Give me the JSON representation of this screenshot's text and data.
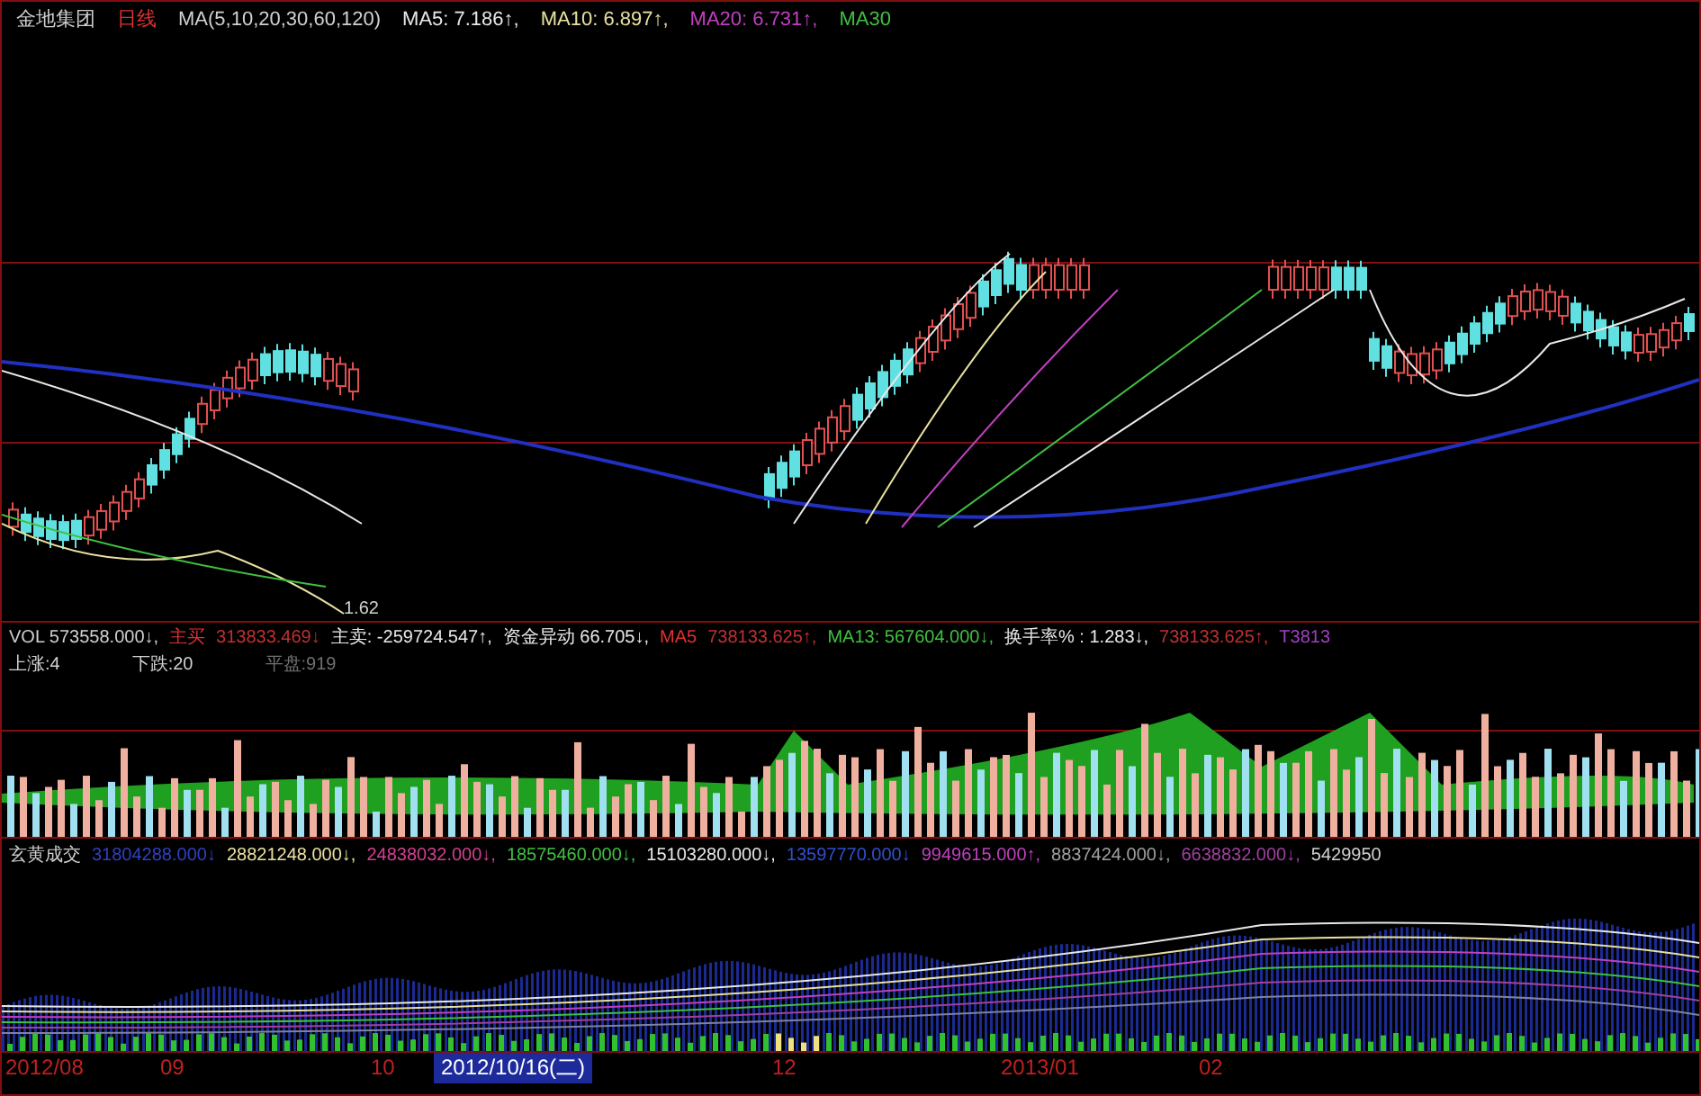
{
  "price_panel": {
    "header": [
      {
        "text": "金地集团",
        "color": "#d0d0d0"
      },
      {
        "text": "日线",
        "color": "#e03030"
      },
      {
        "text": "MA(5,10,20,30,60,120)",
        "color": "#d0d0d0"
      },
      {
        "text": "MA5: 7.186↑,",
        "color": "#e8e8e8"
      },
      {
        "text": "MA10: 6.897↑,",
        "color": "#e8e0a0"
      },
      {
        "text": "MA20: 6.731↑,",
        "color": "#c040c0"
      },
      {
        "text": "MA30",
        "color": "#40c040"
      }
    ],
    "low_label": "1.62"
  },
  "volume_panel": {
    "header": [
      {
        "text": "VOL 573558.000↓,",
        "color": "#d0d0d0"
      },
      {
        "text": "主买",
        "color": "#e03030"
      },
      {
        "text": "313833.469↓",
        "color": "#c03030"
      },
      {
        "text": "主卖: -259724.547↑,",
        "color": "#e8e8e8"
      },
      {
        "text": "资金异动 66.705↓,",
        "color": "#e8e8e8"
      },
      {
        "text": "MA5",
        "color": "#e03030"
      },
      {
        "text": "738133.625↑,",
        "color": "#c03030"
      },
      {
        "text": "MA13: 567604.000↓,",
        "color": "#40c040"
      },
      {
        "text": "换手率% : 1.283↓,",
        "color": "#e8e8e8"
      },
      {
        "text": "738133.625↑,",
        "color": "#c03030"
      },
      {
        "text": "T3813",
        "color": "#a040c0"
      }
    ],
    "stats": [
      {
        "text": "上涨:4",
        "color": "#d0d0d0"
      },
      {
        "text": "下跌:20",
        "color": "#d0d0d0"
      },
      {
        "text": "平盘:919",
        "color": "#707070"
      }
    ]
  },
  "turnover_panel": {
    "header": [
      {
        "text": "玄黄成交",
        "color": "#d0d0d0"
      },
      {
        "text": "31804288.000↓",
        "color": "#3040c0"
      },
      {
        "text": "28821248.000↓,",
        "color": "#e8e0a0"
      },
      {
        "text": "24838032.000↓,",
        "color": "#d04090"
      },
      {
        "text": "18575460.000↓,",
        "color": "#40c040"
      },
      {
        "text": "15103280.000↓,",
        "color": "#e8e8e8"
      },
      {
        "text": "13597770.000↓",
        "color": "#3050d0"
      },
      {
        "text": "9949615.000↑,",
        "color": "#c040c0"
      },
      {
        "text": "8837424.000↓,",
        "color": "#a0a0a0"
      },
      {
        "text": "6638832.000↓,",
        "color": "#a040a0"
      },
      {
        "text": "5429950",
        "color": "#d0d0d0"
      }
    ]
  },
  "date_axis": [
    {
      "text": "2012/08",
      "selected": false
    },
    {
      "text": "09",
      "selected": false
    },
    {
      "text": "10",
      "selected": false
    },
    {
      "text": "2012/10/16(二)",
      "selected": true
    },
    {
      "text": "12",
      "selected": false
    },
    {
      "text": "2013/01",
      "selected": false
    },
    {
      "text": "02",
      "selected": false
    }
  ]
}
